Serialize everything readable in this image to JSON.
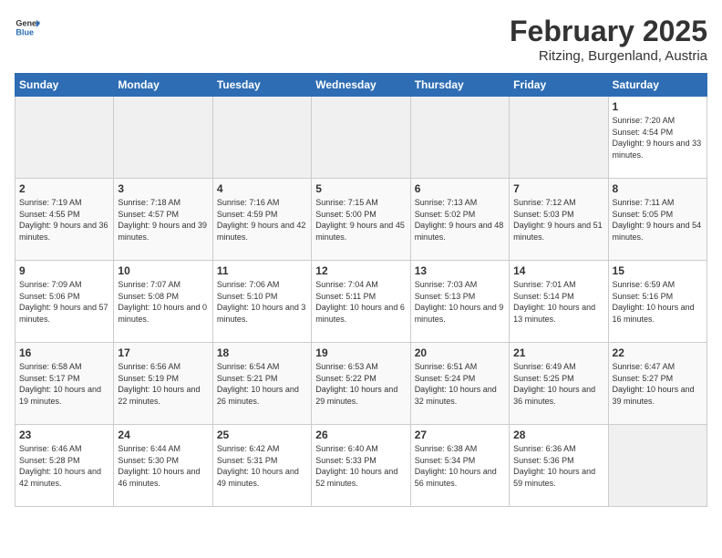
{
  "header": {
    "logo_general": "General",
    "logo_blue": "Blue",
    "title": "February 2025",
    "subtitle": "Ritzing, Burgenland, Austria"
  },
  "days_of_week": [
    "Sunday",
    "Monday",
    "Tuesday",
    "Wednesday",
    "Thursday",
    "Friday",
    "Saturday"
  ],
  "weeks": [
    [
      {
        "day": "",
        "info": ""
      },
      {
        "day": "",
        "info": ""
      },
      {
        "day": "",
        "info": ""
      },
      {
        "day": "",
        "info": ""
      },
      {
        "day": "",
        "info": ""
      },
      {
        "day": "",
        "info": ""
      },
      {
        "day": "1",
        "info": "Sunrise: 7:20 AM\nSunset: 4:54 PM\nDaylight: 9 hours and 33 minutes."
      }
    ],
    [
      {
        "day": "2",
        "info": "Sunrise: 7:19 AM\nSunset: 4:55 PM\nDaylight: 9 hours and 36 minutes."
      },
      {
        "day": "3",
        "info": "Sunrise: 7:18 AM\nSunset: 4:57 PM\nDaylight: 9 hours and 39 minutes."
      },
      {
        "day": "4",
        "info": "Sunrise: 7:16 AM\nSunset: 4:59 PM\nDaylight: 9 hours and 42 minutes."
      },
      {
        "day": "5",
        "info": "Sunrise: 7:15 AM\nSunset: 5:00 PM\nDaylight: 9 hours and 45 minutes."
      },
      {
        "day": "6",
        "info": "Sunrise: 7:13 AM\nSunset: 5:02 PM\nDaylight: 9 hours and 48 minutes."
      },
      {
        "day": "7",
        "info": "Sunrise: 7:12 AM\nSunset: 5:03 PM\nDaylight: 9 hours and 51 minutes."
      },
      {
        "day": "8",
        "info": "Sunrise: 7:11 AM\nSunset: 5:05 PM\nDaylight: 9 hours and 54 minutes."
      }
    ],
    [
      {
        "day": "9",
        "info": "Sunrise: 7:09 AM\nSunset: 5:06 PM\nDaylight: 9 hours and 57 minutes."
      },
      {
        "day": "10",
        "info": "Sunrise: 7:07 AM\nSunset: 5:08 PM\nDaylight: 10 hours and 0 minutes."
      },
      {
        "day": "11",
        "info": "Sunrise: 7:06 AM\nSunset: 5:10 PM\nDaylight: 10 hours and 3 minutes."
      },
      {
        "day": "12",
        "info": "Sunrise: 7:04 AM\nSunset: 5:11 PM\nDaylight: 10 hours and 6 minutes."
      },
      {
        "day": "13",
        "info": "Sunrise: 7:03 AM\nSunset: 5:13 PM\nDaylight: 10 hours and 9 minutes."
      },
      {
        "day": "14",
        "info": "Sunrise: 7:01 AM\nSunset: 5:14 PM\nDaylight: 10 hours and 13 minutes."
      },
      {
        "day": "15",
        "info": "Sunrise: 6:59 AM\nSunset: 5:16 PM\nDaylight: 10 hours and 16 minutes."
      }
    ],
    [
      {
        "day": "16",
        "info": "Sunrise: 6:58 AM\nSunset: 5:17 PM\nDaylight: 10 hours and 19 minutes."
      },
      {
        "day": "17",
        "info": "Sunrise: 6:56 AM\nSunset: 5:19 PM\nDaylight: 10 hours and 22 minutes."
      },
      {
        "day": "18",
        "info": "Sunrise: 6:54 AM\nSunset: 5:21 PM\nDaylight: 10 hours and 26 minutes."
      },
      {
        "day": "19",
        "info": "Sunrise: 6:53 AM\nSunset: 5:22 PM\nDaylight: 10 hours and 29 minutes."
      },
      {
        "day": "20",
        "info": "Sunrise: 6:51 AM\nSunset: 5:24 PM\nDaylight: 10 hours and 32 minutes."
      },
      {
        "day": "21",
        "info": "Sunrise: 6:49 AM\nSunset: 5:25 PM\nDaylight: 10 hours and 36 minutes."
      },
      {
        "day": "22",
        "info": "Sunrise: 6:47 AM\nSunset: 5:27 PM\nDaylight: 10 hours and 39 minutes."
      }
    ],
    [
      {
        "day": "23",
        "info": "Sunrise: 6:46 AM\nSunset: 5:28 PM\nDaylight: 10 hours and 42 minutes."
      },
      {
        "day": "24",
        "info": "Sunrise: 6:44 AM\nSunset: 5:30 PM\nDaylight: 10 hours and 46 minutes."
      },
      {
        "day": "25",
        "info": "Sunrise: 6:42 AM\nSunset: 5:31 PM\nDaylight: 10 hours and 49 minutes."
      },
      {
        "day": "26",
        "info": "Sunrise: 6:40 AM\nSunset: 5:33 PM\nDaylight: 10 hours and 52 minutes."
      },
      {
        "day": "27",
        "info": "Sunrise: 6:38 AM\nSunset: 5:34 PM\nDaylight: 10 hours and 56 minutes."
      },
      {
        "day": "28",
        "info": "Sunrise: 6:36 AM\nSunset: 5:36 PM\nDaylight: 10 hours and 59 minutes."
      },
      {
        "day": "",
        "info": ""
      }
    ]
  ]
}
